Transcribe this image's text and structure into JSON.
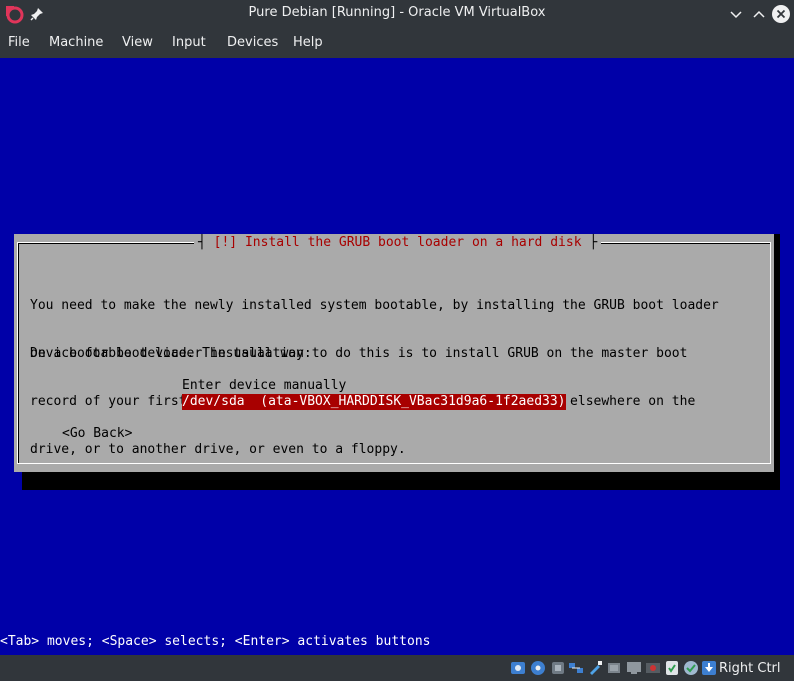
{
  "window": {
    "title": "Pure Debian [Running] - Oracle VM VirtualBox"
  },
  "menubar": {
    "items": [
      "File",
      "Machine",
      "View",
      "Input",
      "Devices",
      "Help"
    ]
  },
  "installer": {
    "dialog_title_prefix": "[!]",
    "dialog_title": "Install the GRUB boot loader on a hard disk",
    "body_lines": [
      "You need to make the newly installed system bootable, by installing the GRUB boot loader",
      "on a bootable device. The usual way to do this is to install GRUB on the master boot",
      "record of your first hard drive. If you prefer, you can install GRUB elsewhere on the",
      "drive, or to another drive, or even to a floppy."
    ],
    "device_label": "Device for boot loader installation:",
    "devices": [
      {
        "label": "Enter device manually",
        "selected": false
      },
      {
        "label": "/dev/sda  (ata-VBOX_HARDDISK_VBac31d9a6-1f2aed33)",
        "selected": true
      }
    ],
    "go_back_label": "<Go Back>",
    "help_line": "<Tab> moves; <Space> selects; <Enter> activates buttons"
  },
  "statusbar": {
    "icons": [
      "hard-disk-icon",
      "optical-drive-icon",
      "audio-icon",
      "network-icon",
      "usb-icon",
      "shared-folders-icon",
      "display-icon",
      "video-capture-icon",
      "mouse-integration-icon",
      "keyboard-capture-icon"
    ],
    "host_key": "Right Ctrl"
  },
  "colors": {
    "guest_background": "#0000a8",
    "dialog_background": "#aaaaaa",
    "title_red": "#a80000",
    "selection_red": "#a80000",
    "chrome_dark": "#31363b"
  }
}
